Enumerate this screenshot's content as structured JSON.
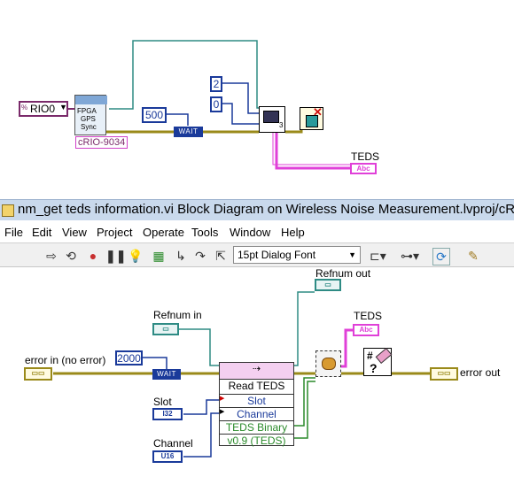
{
  "top_diagram": {
    "rio_control": "RIO0",
    "fpga_icon_lines": [
      "FPGA",
      "GPS",
      "Sync"
    ],
    "chassis_label": "cRIO-9034",
    "wait_ms": "500",
    "wait_label": "WAIT",
    "const_a": "2",
    "const_b": "0",
    "node_index": "3",
    "teds_label": "TEDS"
  },
  "window": {
    "title": "nm_get teds information.vi Block Diagram on Wireless Noise Measurement.lvproj/cR..."
  },
  "menu": [
    "File",
    "Edit",
    "View",
    "Project",
    "Operate",
    "Tools",
    "Window",
    "Help"
  ],
  "toolbar": {
    "font": "15pt Dialog Font"
  },
  "bottom_diagram": {
    "refnum_out": "Refnum out",
    "refnum_in": "Refnum in",
    "teds": "TEDS",
    "error_in": "error in (no error)",
    "error_out": "error out",
    "wait_ms": "2000",
    "wait_label": "WAIT",
    "slot": "Slot",
    "channel": "Channel",
    "i32": "I32",
    "u16": "U16",
    "node": {
      "title": "Read TEDS",
      "rows": [
        "Slot",
        "Channel",
        "TEDS Binary",
        "v0.9 (TEDS)"
      ]
    }
  },
  "colors": {
    "cluster_wire": "#9a8a1a",
    "refnum_wire": "#2e8b84",
    "string_wire": "#e040d8",
    "numeric_wire": "#1a3a9a",
    "purple_wire": "#7a2a6a"
  }
}
